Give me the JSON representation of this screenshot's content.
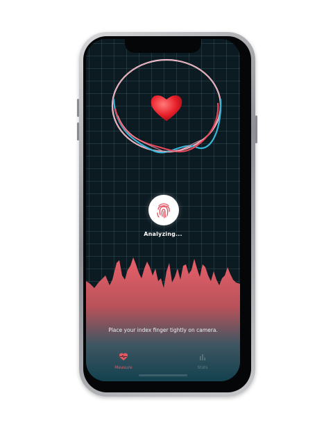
{
  "screen": {
    "status_text": "Analyzing...",
    "instruction": "Place your index finger tightly on camera."
  },
  "icons": {
    "heart": "heart-icon",
    "fingerprint": "fingerprint-icon",
    "measure_tab": "heart-pulse-icon",
    "stats_tab": "bar-chart-icon"
  },
  "tabbar": {
    "measure_label": "Measure",
    "stats_label": "Stats",
    "active_tab": "Measure"
  },
  "colors": {
    "accent": "#e45a62",
    "ring_red": "#e8475a",
    "ring_blue": "#38b6d8",
    "background": "#0c1a21"
  }
}
